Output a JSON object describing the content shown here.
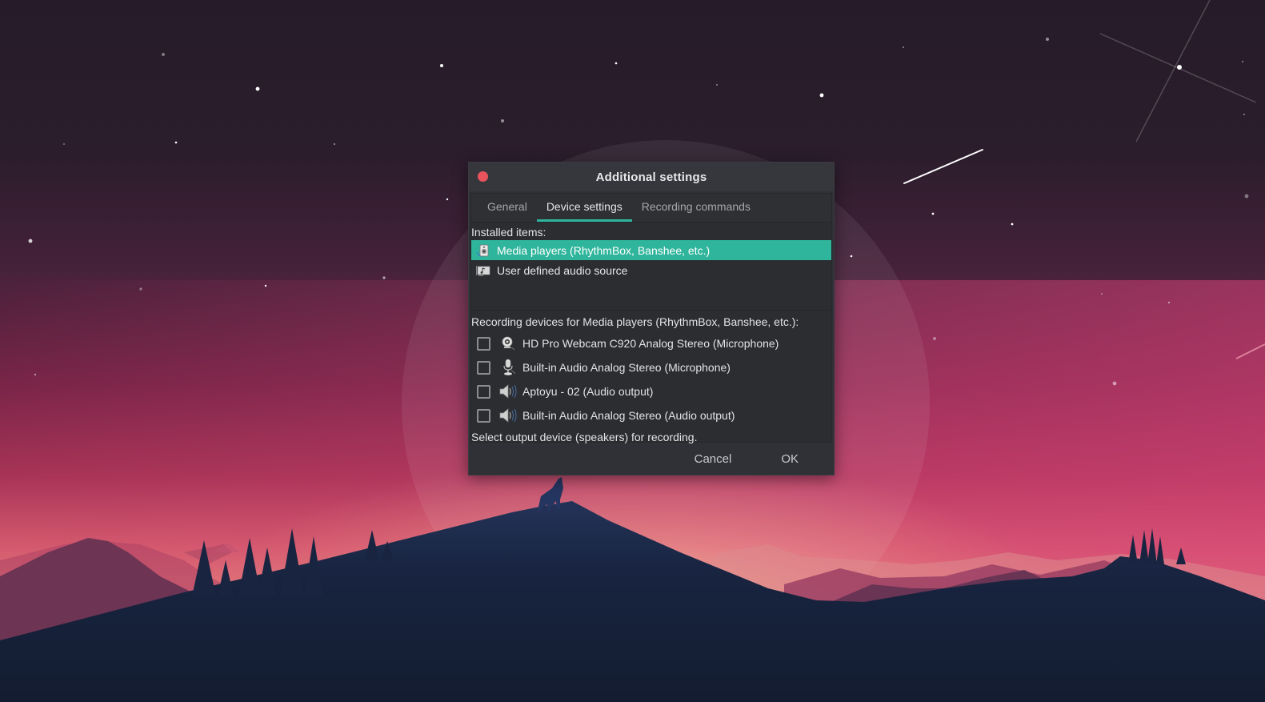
{
  "colors": {
    "accent": "#2fb59b",
    "close_button": "#e9545c",
    "dialog_bg": "#2f3136",
    "titlebar_bg": "#35373c"
  },
  "dialog": {
    "title": "Additional settings",
    "close_icon": "close-dot-icon",
    "tabs": [
      {
        "label": "General",
        "active": false
      },
      {
        "label": "Device settings",
        "active": true
      },
      {
        "label": "Recording commands",
        "active": false
      }
    ],
    "installed_items_label": "Installed items:",
    "installed_items": [
      {
        "label": "Media players (RhythmBox, Banshee, etc.)",
        "icon": "speaker-box-icon",
        "selected": true
      },
      {
        "label": "User defined audio source",
        "icon": "music-screen-icon",
        "selected": false
      }
    ],
    "recording_devices_label": "Recording devices for Media players (RhythmBox, Banshee, etc.):",
    "recording_devices": [
      {
        "label": "HD Pro Webcam C920 Analog Stereo (Microphone)",
        "icon": "webcam-icon",
        "checked": false
      },
      {
        "label": "Built-in Audio Analog Stereo (Microphone)",
        "icon": "microphone-icon",
        "checked": false
      },
      {
        "label": "Aptoyu  -  02 (Audio output)",
        "icon": "speaker-icon",
        "checked": false
      },
      {
        "label": "Built-in Audio Analog Stereo (Audio output)",
        "icon": "speaker-icon",
        "checked": false
      }
    ],
    "hint": "Select output device (speakers) for recording.",
    "buttons": {
      "cancel": "Cancel",
      "ok": "OK"
    }
  }
}
